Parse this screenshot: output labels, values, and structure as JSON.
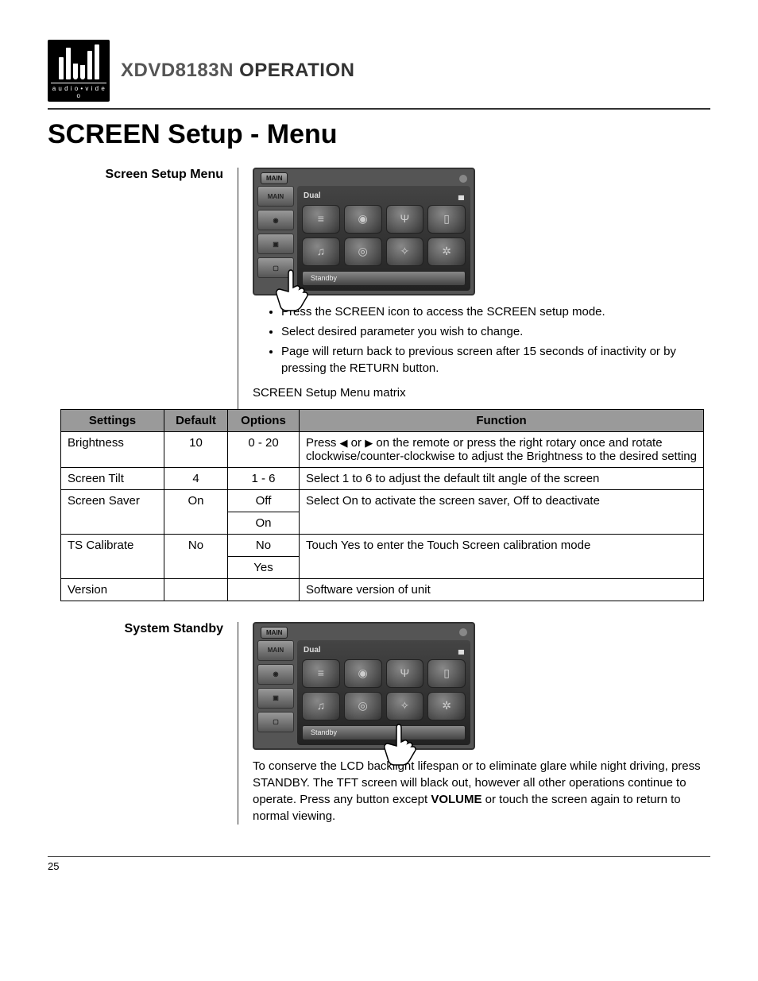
{
  "logo_sub": "a u d i o • v i d e o",
  "header": {
    "model": "XDVD8183N",
    "section": "OPERATION"
  },
  "page_heading": "SCREEN Setup - Menu",
  "sec1": {
    "label": "Screen Setup Menu",
    "device": {
      "tab": "MAIN",
      "main_btn": "MAIN",
      "brand": "Dual",
      "standby": "Standby"
    },
    "bullets": [
      "Press the SCREEN icon to access the SCREEN setup mode.",
      "Select desired parameter you wish to change.",
      "Page will return back to previous screen after 15 seconds of inactivity or by pressing the RETURN button."
    ],
    "matrix_caption": "SCREEN Setup Menu matrix"
  },
  "table": {
    "headers": {
      "settings": "Settings",
      "default": "Default",
      "options": "Options",
      "function": "Function"
    },
    "rows": {
      "brightness": {
        "setting": "Brightness",
        "default": "10",
        "option": "0 - 20",
        "fn_prefix": "Press ",
        "fn_mid": " or ",
        "fn_rest": " on the remote or press the right rotary once and rotate clockwise/counter-clockwise to adjust the Brightness to the desired setting"
      },
      "tilt": {
        "setting": "Screen Tilt",
        "default": "4",
        "option": "1 - 6",
        "fn": "Select 1 to 6 to adjust the default tilt angle of the screen"
      },
      "saver": {
        "setting": "Screen Saver",
        "default": "On",
        "opt1": "Off",
        "opt2": "On",
        "fn": "Select On to activate the screen saver, Off to deactivate"
      },
      "ts": {
        "setting": "TS Calibrate",
        "default": "No",
        "opt1": "No",
        "opt2": "Yes",
        "fn": "Touch Yes to enter the Touch Screen calibration mode"
      },
      "version": {
        "setting": "Version",
        "default": "",
        "option": "",
        "fn": "Software version of unit"
      }
    }
  },
  "sec2": {
    "label": "System Standby",
    "para_prefix": "To conserve the LCD backlight lifespan or to eliminate glare while night driving, press STANDBY. The TFT screen will black out, however all other operations continue to operate. Press any button except ",
    "para_bold": "VOLUME",
    "para_suffix": " or touch the screen again to return to normal viewing."
  },
  "page_number": "25"
}
